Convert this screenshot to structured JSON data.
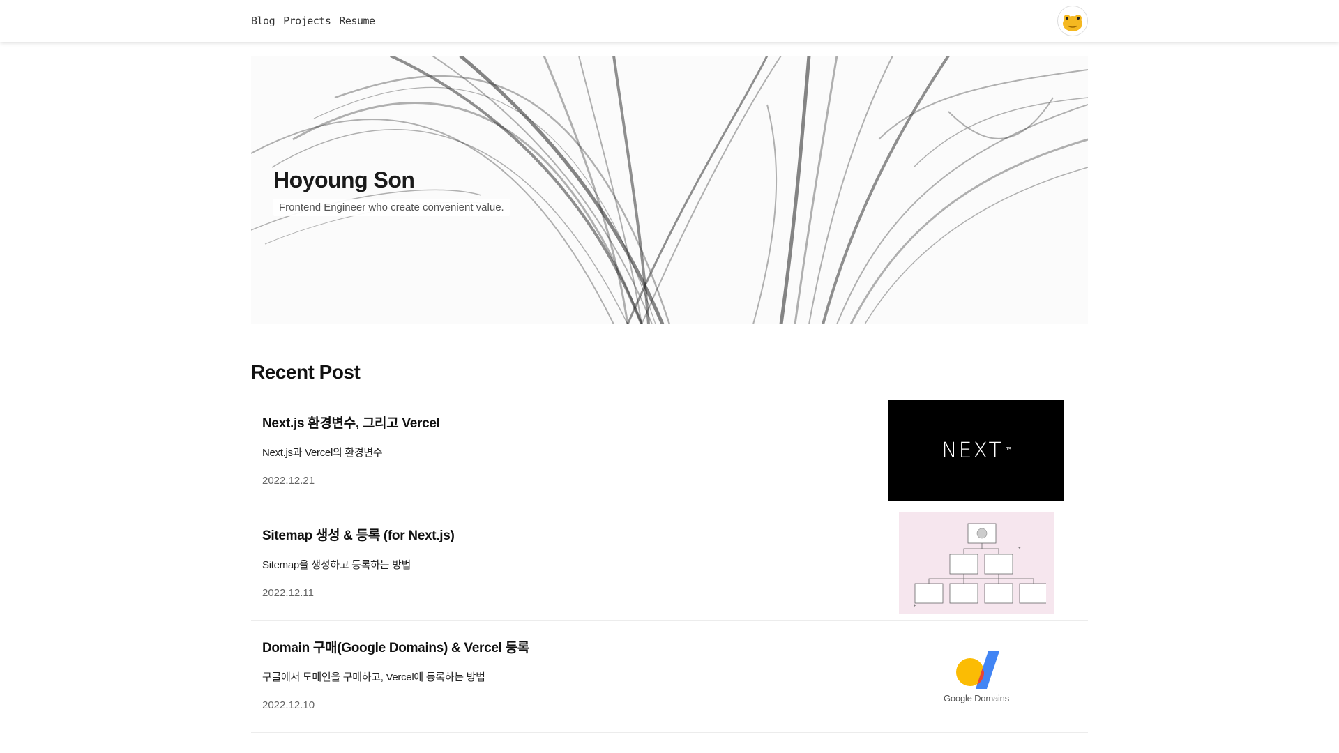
{
  "header": {
    "nav": [
      {
        "label": "Blog"
      },
      {
        "label": "Projects"
      },
      {
        "label": "Resume"
      }
    ],
    "avatar_icon": "frog-avatar-icon"
  },
  "hero": {
    "name": "Hoyoung Son",
    "tagline": "Frontend Engineer who create convenient value."
  },
  "recent": {
    "title": "Recent Post",
    "posts": [
      {
        "title": "Next.js 환경변수, 그리고 Vercel",
        "description": "Next.js과 Vercel의 환경변수",
        "date": "2022.12.21",
        "thumb_icon": "nextjs-logo-icon",
        "thumb_text": "NEXT",
        "thumb_suffix": ".JS"
      },
      {
        "title": "Sitemap 생성 & 등록 (for Next.js)",
        "description": "Sitemap을 생성하고 등록하는 방법",
        "date": "2022.12.11",
        "thumb_icon": "sitemap-diagram-icon"
      },
      {
        "title": "Domain 구매(Google Domains) & Vercel 등록",
        "description": "구글에서 도메인을 구매하고, Vercel에 등록하는 방법",
        "date": "2022.12.10",
        "thumb_icon": "google-domains-logo-icon",
        "thumb_text": "Google Domains"
      }
    ]
  },
  "colors": {
    "sitemap_bg": "#f6e6ee",
    "google_yellow": "#fbbc04",
    "google_blue": "#4285f4",
    "google_red": "#ea4335"
  }
}
